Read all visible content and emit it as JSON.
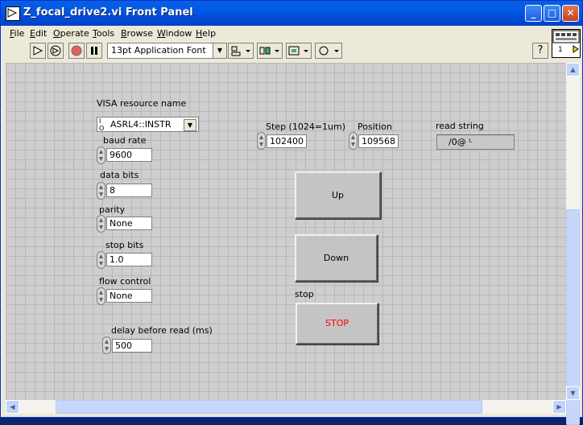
{
  "window": {
    "title": "Z_focal_drive2.vi Front Panel"
  },
  "titlebar_buttons": {
    "minimize": "_",
    "maximize": "□",
    "close": "✕"
  },
  "menu": [
    {
      "label_u": "F",
      "label_rest": "ile"
    },
    {
      "label_u": "E",
      "label_rest": "dit"
    },
    {
      "label_u": "O",
      "label_rest": "perate"
    },
    {
      "label_u": "T",
      "label_rest": "ools"
    },
    {
      "label_u": "B",
      "label_rest": "rowse"
    },
    {
      "label_u": "W",
      "label_rest": "indow"
    },
    {
      "label_u": "H",
      "label_rest": "elp"
    }
  ],
  "toolbar": {
    "font": "13pt Application Font",
    "help": "?"
  },
  "vi_icon": {
    "number": "1"
  },
  "controls": {
    "visa": {
      "label": "VISA resource name",
      "value": "ASRL4::INSTR",
      "prefix": "I/O"
    },
    "baud": {
      "label": "baud rate",
      "value": "9600"
    },
    "data_bits": {
      "label": "data bits",
      "value": "8"
    },
    "parity": {
      "label": "parity",
      "value": "None"
    },
    "stop_bits": {
      "label": "stop bits",
      "value": "1.0"
    },
    "flow": {
      "label": "flow control",
      "value": "None"
    },
    "delay": {
      "label": "delay before read (ms)",
      "value": "500"
    },
    "step": {
      "label": "Step (1024=1um)",
      "value": "102400"
    },
    "position": {
      "label": "Position",
      "value": "109568"
    },
    "read_string": {
      "label": "read string",
      "value": "/0@ ᴸ"
    },
    "up": {
      "label": "Up"
    },
    "down": {
      "label": "Down"
    },
    "stop": {
      "label": "stop",
      "button": "STOP",
      "color": "#ff0000"
    }
  },
  "colors": {
    "titlebar": "#0058e6",
    "panel": "#cecece",
    "grid": "#b8b8b8"
  }
}
